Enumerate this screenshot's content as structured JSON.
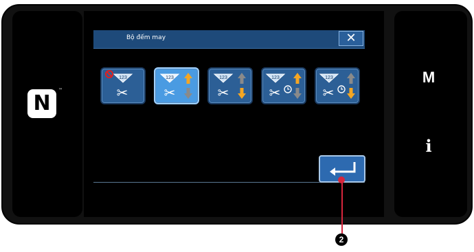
{
  "dialog": {
    "title": "Bộ đếm may",
    "close_label": "✕"
  },
  "side": {
    "m_label": "M",
    "info_label": "i",
    "nfc_label": "N",
    "nfc_tm": "™"
  },
  "counter_modes": [
    {
      "id": "disabled",
      "icon": "counter-disabled-icon",
      "count_text": "123",
      "selected": false
    },
    {
      "id": "up-thread-trim",
      "icon": "count-up-icon",
      "count_text": "123",
      "selected": true
    },
    {
      "id": "down-thread-trim",
      "icon": "count-down-icon",
      "count_text": "123",
      "selected": false
    },
    {
      "id": "up-timed",
      "icon": "count-up-timed-icon",
      "count_text": "123",
      "selected": false
    },
    {
      "id": "down-timed",
      "icon": "count-down-timed-icon",
      "count_text": "123",
      "selected": false
    }
  ],
  "enter": {
    "icon": "enter-return-icon"
  },
  "callout": {
    "number": "2"
  },
  "colors": {
    "panel": "#111111",
    "title_bar": "#1e4a7a",
    "button": "#2c5f96",
    "selected_button": "#4a9be2",
    "arrow_active": "#f5a623",
    "arrow_inactive": "#8a8a8a",
    "callout": "#d7263d"
  }
}
